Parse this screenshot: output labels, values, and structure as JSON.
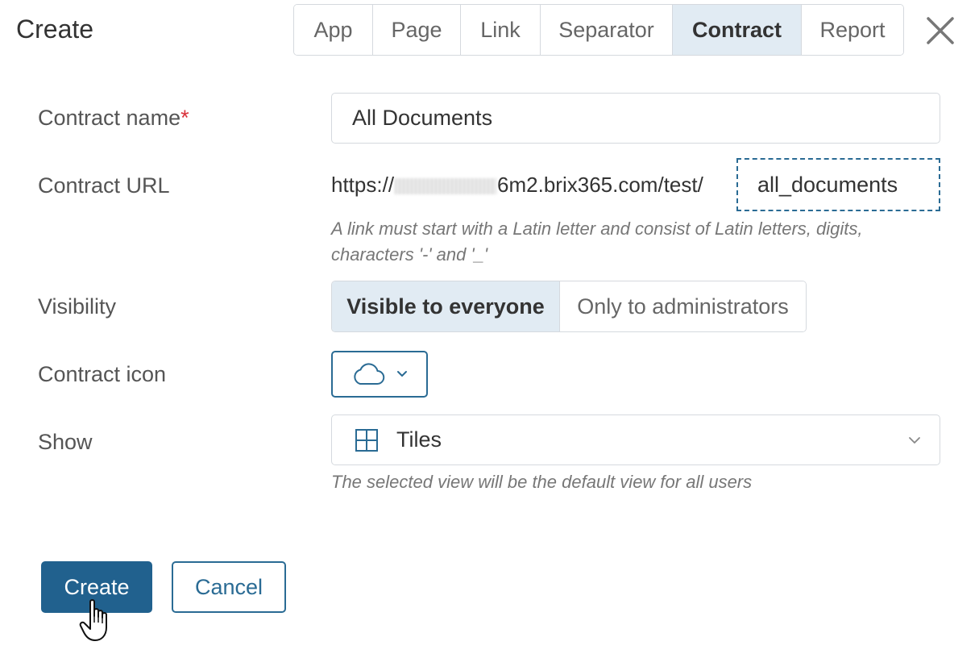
{
  "dialog": {
    "title": "Create",
    "tabs": [
      {
        "label": "App",
        "active": false
      },
      {
        "label": "Page",
        "active": false
      },
      {
        "label": "Link",
        "active": false
      },
      {
        "label": "Separator",
        "active": false
      },
      {
        "label": "Contract",
        "active": true
      },
      {
        "label": "Report",
        "active": false
      }
    ],
    "close_icon": "close-icon"
  },
  "form": {
    "contract_name": {
      "label": "Contract name",
      "required_mark": "*",
      "value": "All Documents"
    },
    "contract_url": {
      "label": "Contract URL",
      "prefix_start": "https://",
      "prefix_end": "6m2.brix365.com/test/",
      "slug": "all_documents",
      "hint_line1": "A link must start with a Latin letter and consist of Latin letters, digits,",
      "hint_line2": "characters '-' and '_'"
    },
    "visibility": {
      "label": "Visibility",
      "options": [
        "Visible to everyone",
        "Only to administrators"
      ],
      "selected": "Visible to everyone"
    },
    "contract_icon": {
      "label": "Contract icon",
      "icon": "cloud-icon"
    },
    "show": {
      "label": "Show",
      "value": "Tiles",
      "icon": "tiles-icon",
      "hint": "The selected view will be the default view for all users"
    }
  },
  "actions": {
    "create_label": "Create",
    "cancel_label": "Cancel"
  },
  "colors": {
    "accent": "#21618e",
    "active_bg": "#e1ebf3",
    "required": "#d9303a"
  }
}
